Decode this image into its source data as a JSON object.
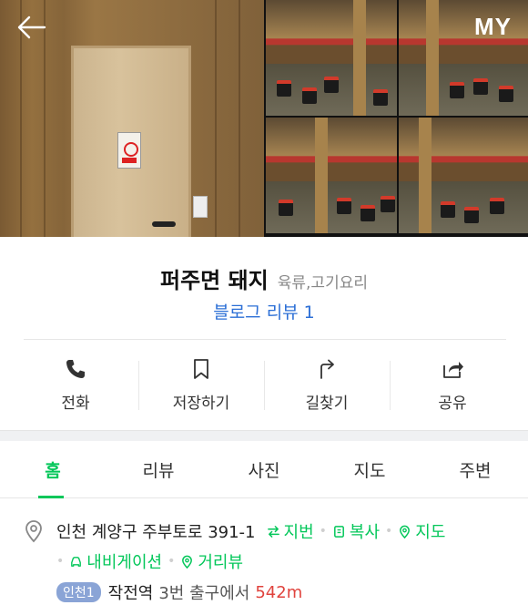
{
  "header": {
    "my_label": "MY",
    "back_icon": "arrow-left-icon"
  },
  "place": {
    "name": "퍼주면 돼지",
    "category": "육류,고기요리",
    "blog_review_label": "블로그 리뷰",
    "blog_review_count": "1"
  },
  "actions": [
    {
      "label": "전화",
      "icon": "phone-icon"
    },
    {
      "label": "저장하기",
      "icon": "bookmark-icon"
    },
    {
      "label": "길찾기",
      "icon": "directions-icon"
    },
    {
      "label": "공유",
      "icon": "share-icon"
    }
  ],
  "tabs": [
    {
      "label": "홈",
      "active": true
    },
    {
      "label": "리뷰",
      "active": false
    },
    {
      "label": "사진",
      "active": false
    },
    {
      "label": "지도",
      "active": false
    },
    {
      "label": "주변",
      "active": false
    }
  ],
  "address": {
    "text": "인천 계양구 주부토로 391-1",
    "links": {
      "jibeon": "지번",
      "copy": "복사",
      "map": "지도",
      "navigation": "내비게이션",
      "street_view": "거리뷰"
    },
    "subway": {
      "line_badge": "인천1",
      "station": "작전역",
      "exit_text": "3번 출구에서",
      "distance": "542m"
    }
  },
  "colors": {
    "accent_green": "#03c75a",
    "link_blue": "#2c6fd6",
    "distance_red": "#e0433d",
    "subway_badge": "#8aa4d6"
  }
}
